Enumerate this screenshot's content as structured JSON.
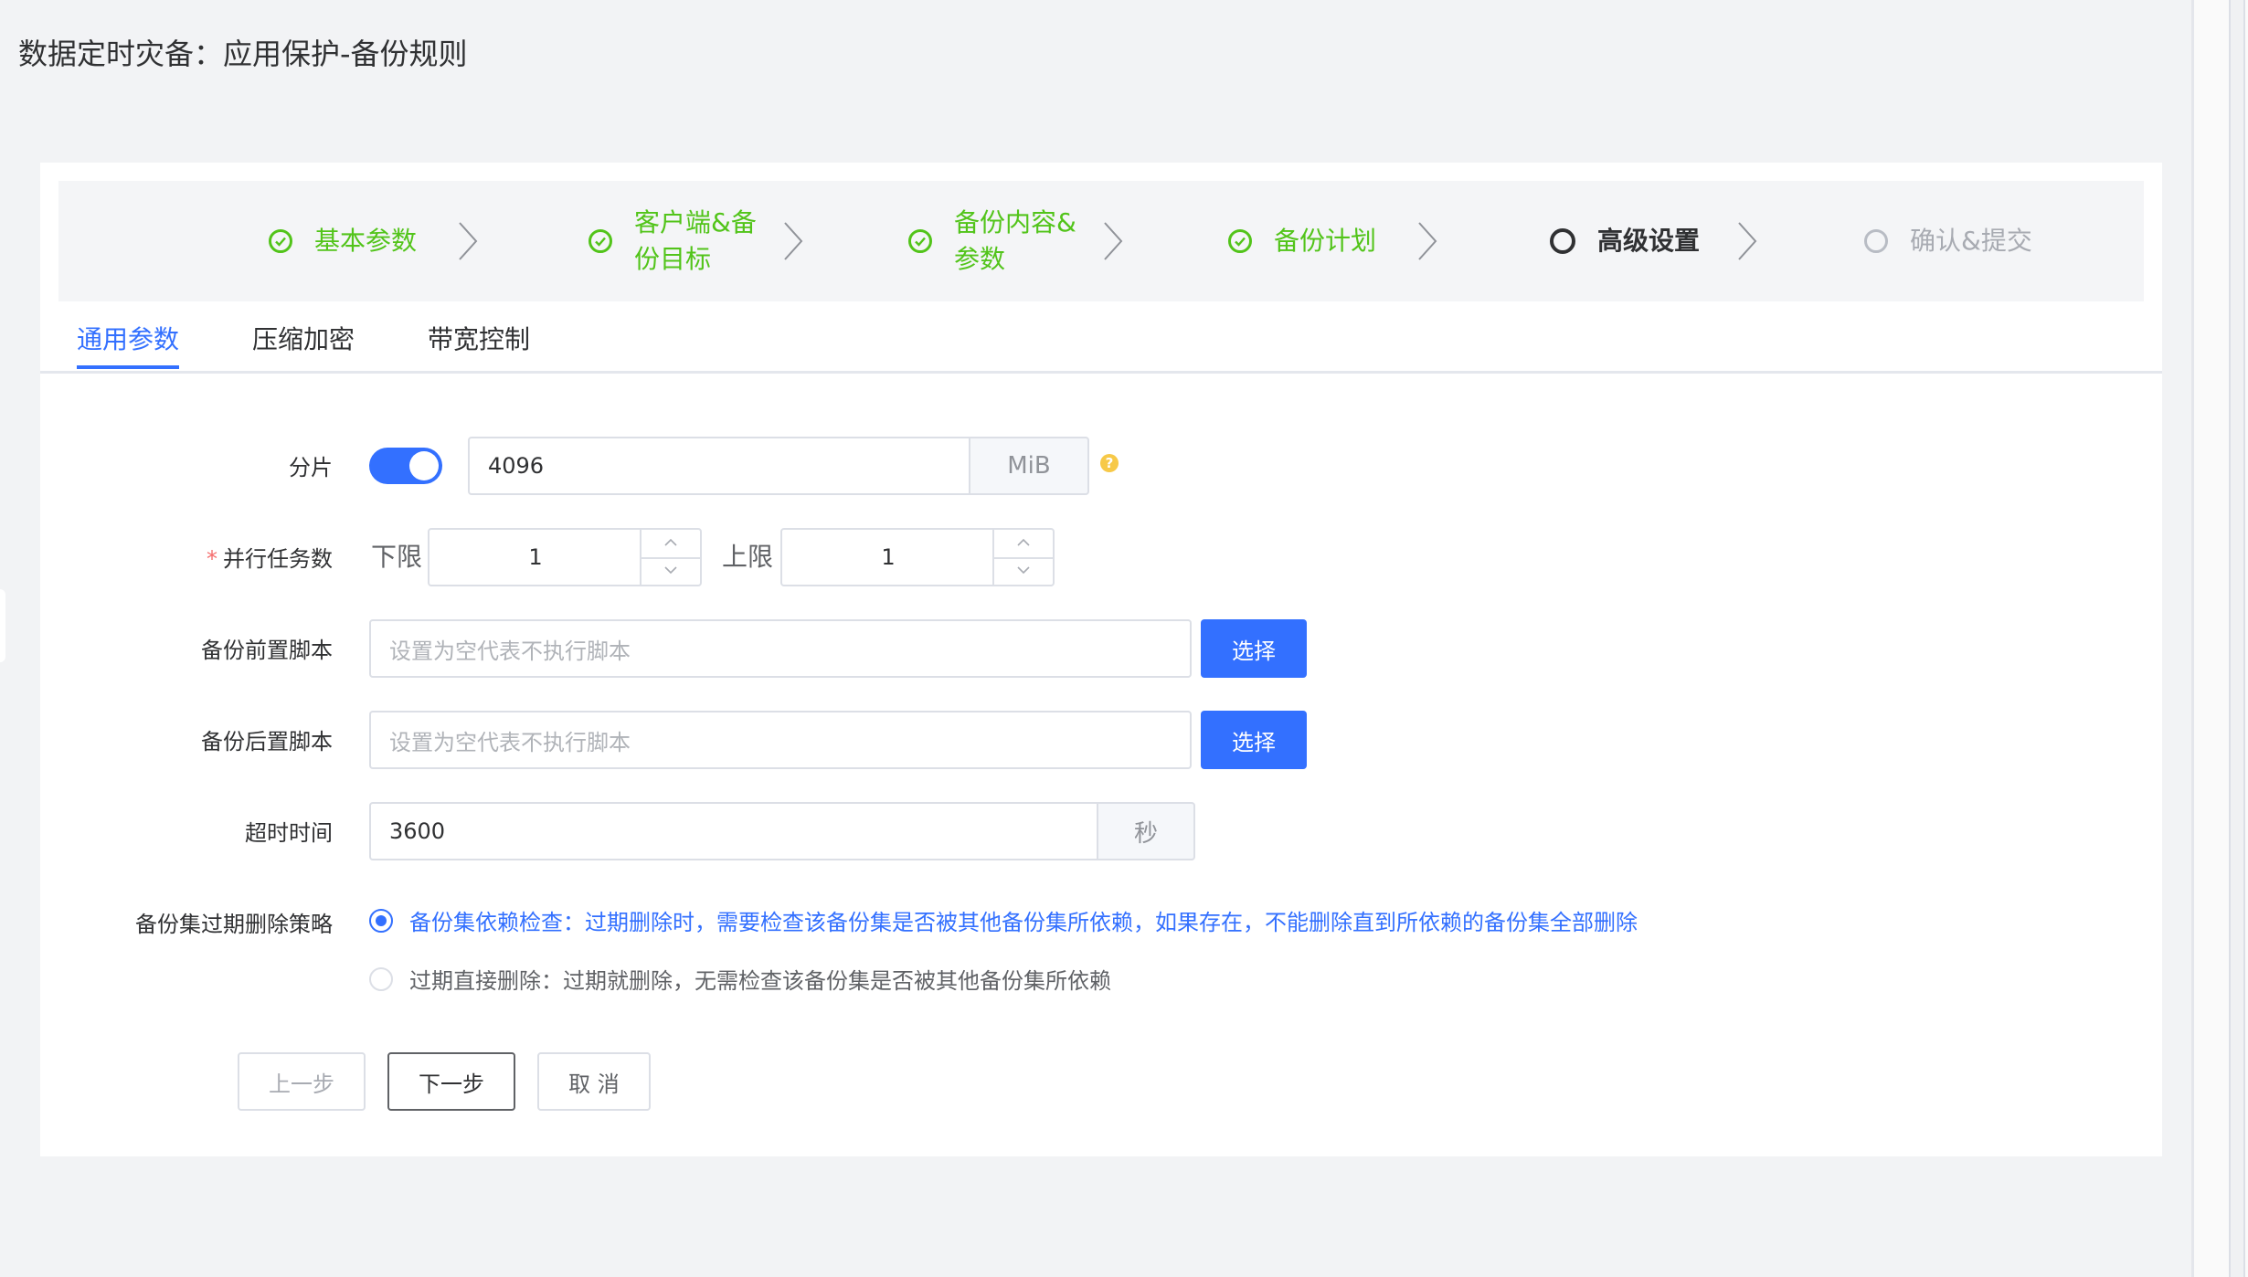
{
  "page": {
    "title": "数据定时灾备：应用保护-备份规则"
  },
  "steps": [
    {
      "label_line1": "基本参数",
      "label_line2": "",
      "state": "done"
    },
    {
      "label_line1": "客户端&备",
      "label_line2": "份目标",
      "state": "done"
    },
    {
      "label_line1": "备份内容&",
      "label_line2": "参数",
      "state": "done"
    },
    {
      "label_line1": "备份计划",
      "label_line2": "",
      "state": "done"
    },
    {
      "label_line1": "高级设置",
      "label_line2": "",
      "state": "active"
    },
    {
      "label_line1": "确认&提交",
      "label_line2": "",
      "state": "todo"
    }
  ],
  "tabs": [
    {
      "label": "通用参数",
      "active": true
    },
    {
      "label": "压缩加密",
      "active": false
    },
    {
      "label": "带宽控制",
      "active": false
    }
  ],
  "form": {
    "slice": {
      "label": "分片",
      "enabled": true,
      "value": "4096",
      "unit": "MiB",
      "help": "?"
    },
    "parallel": {
      "required_mark": "*",
      "label": "并行任务数",
      "lower_label": "下限",
      "lower_value": "1",
      "upper_label": "上限",
      "upper_value": "1"
    },
    "pre_script": {
      "label": "备份前置脚本",
      "placeholder": "设置为空代表不执行脚本",
      "button": "选择"
    },
    "post_script": {
      "label": "备份后置脚本",
      "placeholder": "设置为空代表不执行脚本",
      "button": "选择"
    },
    "timeout": {
      "label": "超时时间",
      "value": "3600",
      "unit": "秒"
    },
    "expire_policy": {
      "label": "备份集过期删除策略",
      "options": [
        {
          "text": "备份集依赖检查：过期删除时，需要检查该备份集是否被其他备份集所依赖，如果存在，不能删除直到所依赖的备份集全部删除",
          "selected": true
        },
        {
          "text": "过期直接删除：过期就删除，无需检查该备份集是否被其他备份集所依赖",
          "selected": false
        }
      ]
    }
  },
  "actions": {
    "prev": "上一步",
    "next": "下一步",
    "cancel": "取 消"
  },
  "colors": {
    "accent": "#3370ff",
    "success": "#52c41a",
    "required": "#f56c6c",
    "help": "#f7c948"
  }
}
